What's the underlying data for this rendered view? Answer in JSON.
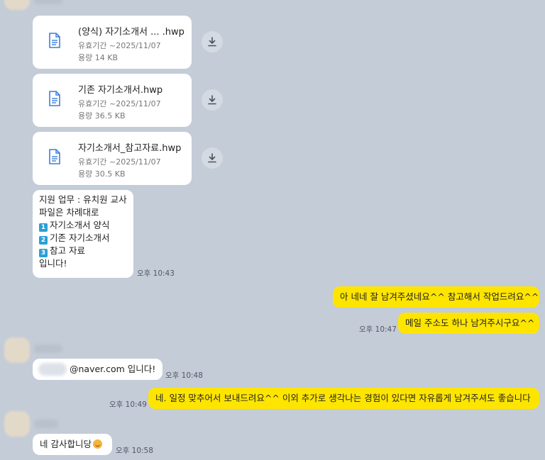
{
  "files": [
    {
      "name": "(양식) 자기소개서 ...   .hwp",
      "expiry": "유효기간 ~2025/11/07",
      "size": "용량 14 KB"
    },
    {
      "name": "기존 자기소개서.hwp",
      "expiry": "유효기간 ~2025/11/07",
      "size": "용량 36.5 KB"
    },
    {
      "name": "자기소개서_참고자료.hwp",
      "expiry": "유효기간 ~2025/11/07",
      "size": "용량 30.5 KB"
    }
  ],
  "messages": {
    "m1": {
      "line1": "지원 업무 : 유치원 교사",
      "line2": "파일은 차례대로",
      "items": [
        {
          "num": "1",
          "text": "자기소개서 양식"
        },
        {
          "num": "2",
          "text": "기존 자기소개서"
        },
        {
          "num": "3",
          "text": "참고 자료"
        }
      ],
      "line_end": "입니다!",
      "time": "오후 10:43"
    },
    "m2": {
      "text": "아 네네 잘 남겨주셨네요^^ 참고해서 작업드려요^^"
    },
    "m3": {
      "text": "메일 주소도 하나 남겨주시구요^^",
      "time": "오후 10:47"
    },
    "m4": {
      "text": "@naver.com 입니다!",
      "time": "오후 10:48"
    },
    "m5": {
      "text": "네. 일정 맞추어서 보내드려요^^ 이외 추가로 생각나는 경험이 있다면 자유롭게 남겨주셔도 좋습니다",
      "time": "오후 10:49"
    },
    "m6": {
      "text": "네 감사합니당",
      "time": "오후 10:58"
    }
  },
  "icons": {
    "file": "document-icon",
    "download": "download-icon",
    "emoji": "smiling-face-emoji"
  },
  "colors": {
    "background": "#c3ccd7",
    "my_bubble": "#fee500",
    "their_bubble": "#ffffff"
  }
}
